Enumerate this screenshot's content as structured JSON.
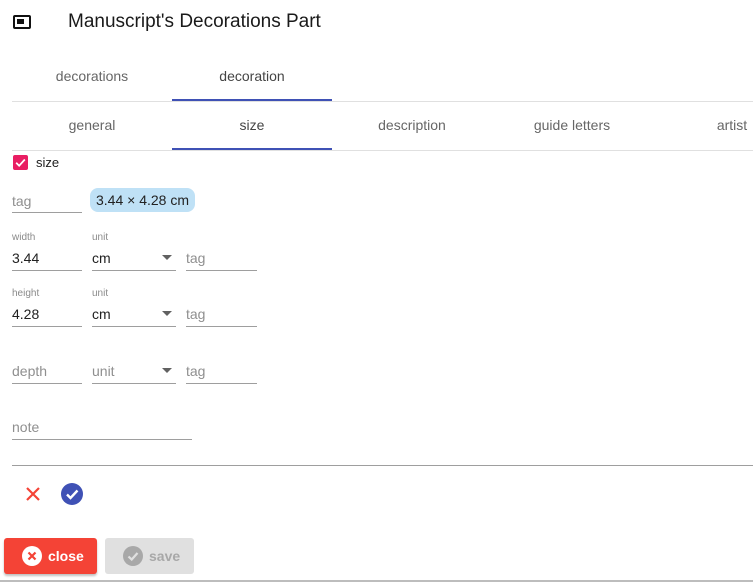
{
  "header": {
    "title": "Manuscript's Decorations Part",
    "icon": "picture-in-picture-icon"
  },
  "top_tabs": [
    {
      "label": "decorations",
      "active": false
    },
    {
      "label": "decoration",
      "active": true
    }
  ],
  "sub_tabs": [
    {
      "label": "general",
      "active": false
    },
    {
      "label": "size",
      "active": true
    },
    {
      "label": "description",
      "active": false
    },
    {
      "label": "guide letters",
      "active": false
    },
    {
      "label": "artist",
      "active": false
    }
  ],
  "form": {
    "size_checkbox": {
      "label": "size",
      "checked": true
    },
    "tag": {
      "placeholder": "tag",
      "value": ""
    },
    "size_chip": "3.44 × 4.28 cm",
    "width": {
      "label": "width",
      "value": "3.44",
      "unit_label": "unit",
      "unit": "cm",
      "tag_placeholder": "tag"
    },
    "height": {
      "label": "height",
      "value": "4.28",
      "unit_label": "unit",
      "unit": "cm",
      "tag_placeholder": "tag"
    },
    "depth": {
      "placeholder": "depth",
      "unit_placeholder": "unit",
      "tag_placeholder": "tag"
    },
    "note": {
      "placeholder": "note"
    }
  },
  "actions": {
    "close_label": "close",
    "save_label": "save",
    "save_enabled": false
  },
  "colors": {
    "primary": "#3f51b5",
    "accent": "#e91e63",
    "warn": "#f44336",
    "chip": "#bfe1f6"
  }
}
